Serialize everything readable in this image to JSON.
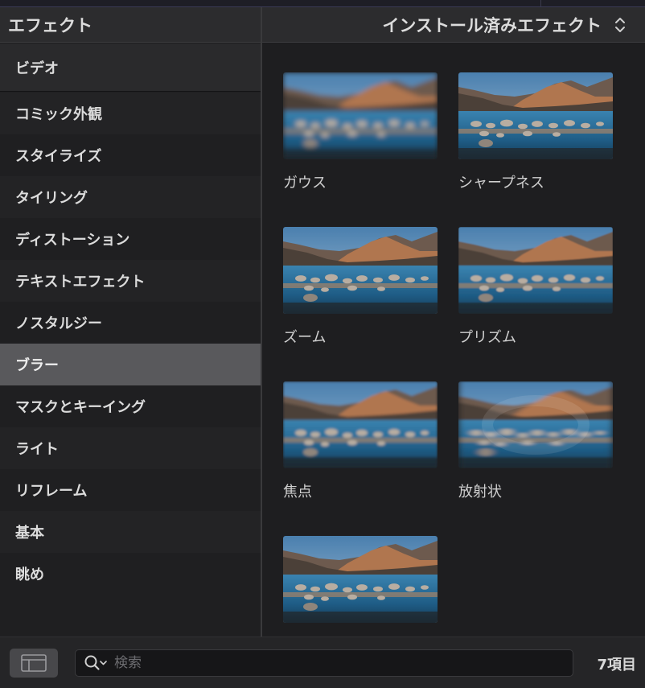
{
  "panel": {
    "title": "エフェクト"
  },
  "browser": {
    "title": "インストール済みエフェクト"
  },
  "sidebar": {
    "items": [
      {
        "label": "ビデオ"
      },
      {
        "label": "コミック外観"
      },
      {
        "label": "スタイライズ"
      },
      {
        "label": "タイリング"
      },
      {
        "label": "ディストーション"
      },
      {
        "label": "テキストエフェクト"
      },
      {
        "label": "ノスタルジー"
      },
      {
        "label": "ブラー",
        "selected": true
      },
      {
        "label": "マスクとキーイング"
      },
      {
        "label": "ライト"
      },
      {
        "label": "リフレーム"
      },
      {
        "label": "基本"
      },
      {
        "label": "眺め"
      }
    ]
  },
  "effects": [
    {
      "name": "ガウス",
      "style": "gauss"
    },
    {
      "name": "シャープネス",
      "style": "sharp"
    },
    {
      "name": "ズーム",
      "style": "sharp"
    },
    {
      "name": "プリズム",
      "style": "prism"
    },
    {
      "name": "焦点",
      "style": "focus"
    },
    {
      "name": "放射状",
      "style": "radial"
    },
    {
      "name": "",
      "style": "sharp"
    }
  ],
  "footer": {
    "search_placeholder": "検索",
    "item_count": "7項目"
  },
  "colors": {
    "selected_row": "#59595c",
    "background": "#1c1c1e",
    "header": "#2c2c2e"
  },
  "icons": {
    "layout_toggle": "sidebar-layout-icon",
    "search": "magnifier-with-chevron-icon",
    "popup": "up-down-chevron-icon"
  }
}
